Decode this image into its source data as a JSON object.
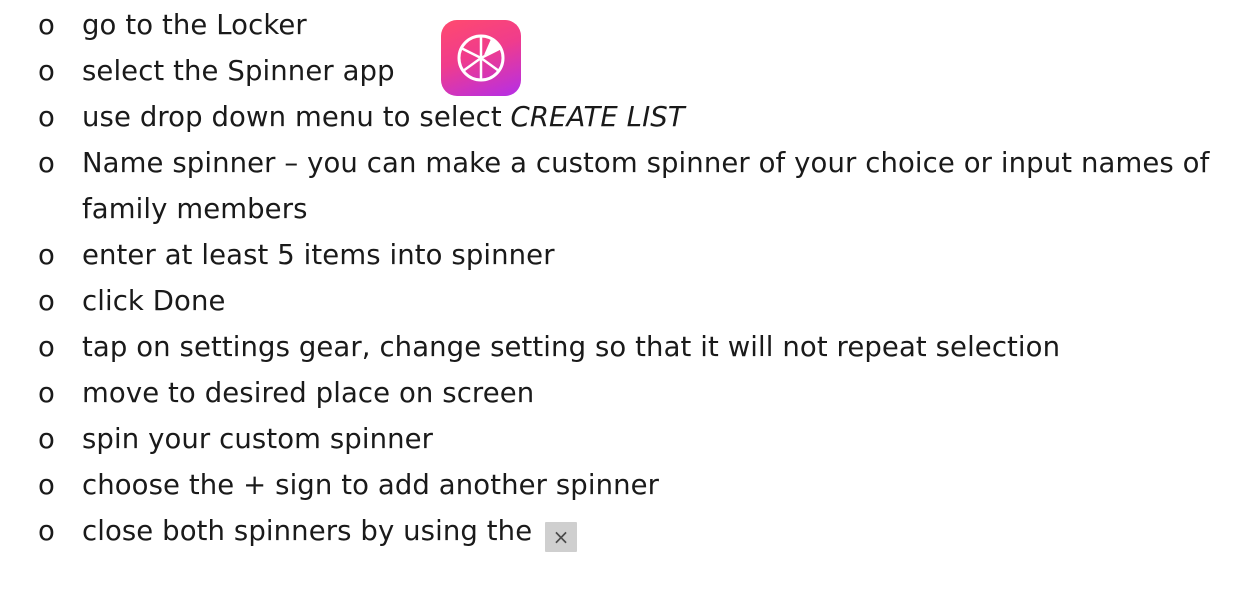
{
  "bullet_glyph": "o",
  "items": [
    {
      "text": "go to the Locker"
    },
    {
      "text": "select the Spinner app",
      "icon": "spinner-app-icon"
    },
    {
      "text": "use drop down menu to select ",
      "emphasis": "CREATE LIST"
    },
    {
      "text": "Name spinner – you can make a custom spinner of your choice or input names of family members"
    },
    {
      "text": "enter at least 5 items into spinner"
    },
    {
      "text": "click Done"
    },
    {
      "text": "tap on settings gear, change setting so that it will not repeat selection"
    },
    {
      "text": "move to desired place on screen"
    },
    {
      "text": "spin your custom spinner"
    },
    {
      "text": "choose the + sign to add another spinner"
    },
    {
      "text": "close both spinners by using the",
      "icon": "close-x-icon",
      "icon_glyph": "×"
    }
  ],
  "colors": {
    "text": "#1a1a1a",
    "app_icon_gradient_start": "#ff4a6e",
    "app_icon_gradient_end": "#b42ee8",
    "close_box_bg": "#cfcfcf"
  }
}
